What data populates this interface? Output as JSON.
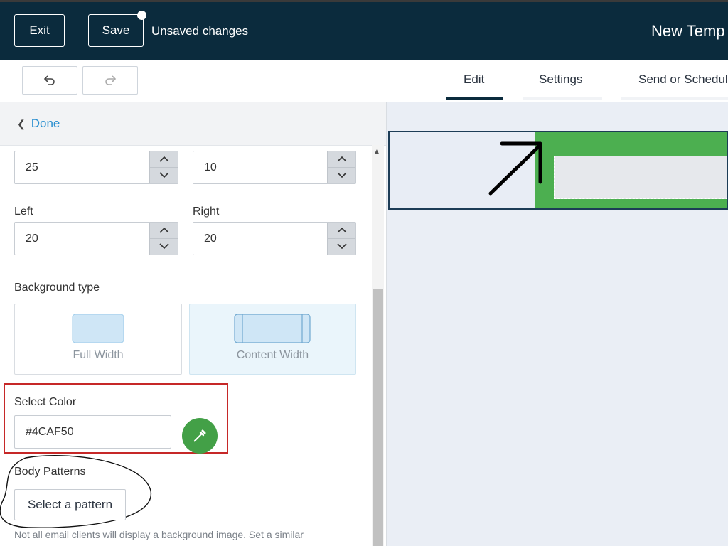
{
  "header": {
    "exit_label": "Exit",
    "save_label": "Save",
    "unsaved_text": "Unsaved changes",
    "title": "New Temp"
  },
  "toolbar": {
    "undo_icon": "undo-icon",
    "redo_icon": "redo-icon",
    "tabs": [
      {
        "label": "Edit",
        "active": true
      },
      {
        "label": "Settings",
        "active": false
      },
      {
        "label": "Send or Schedul",
        "active": false
      }
    ]
  },
  "panel": {
    "done_label": "Done",
    "padding": {
      "top_value": "25",
      "bottom_value": "10",
      "left_label": "Left",
      "left_value": "20",
      "right_label": "Right",
      "right_value": "20"
    },
    "background_type": {
      "label": "Background type",
      "options": [
        {
          "label": "Full Width",
          "selected": false
        },
        {
          "label": "Content Width",
          "selected": true
        }
      ]
    },
    "select_color": {
      "label": "Select Color",
      "value": "#4CAF50"
    },
    "body_patterns": {
      "label": "Body Patterns",
      "button_label": "Select a pattern",
      "hint": "Not all email clients will display a background image. Set a similar"
    }
  },
  "colors": {
    "header_bg": "#0b2b3d",
    "accent_green": "#4caf50",
    "link_blue": "#2a8fd0",
    "highlight_red": "#c62828"
  }
}
